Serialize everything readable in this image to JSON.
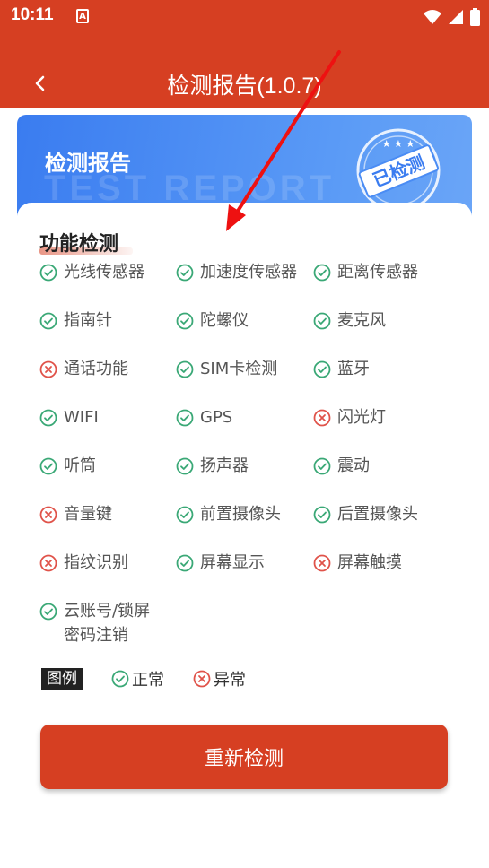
{
  "status": {
    "time": "10:11",
    "app_badge": "A"
  },
  "header": {
    "title": "检测报告(1.0.7)"
  },
  "banner": {
    "title": "检测报告",
    "watermark": "TEST REPORT",
    "stamp": "已检测"
  },
  "section": {
    "title": "功能检测"
  },
  "items": [
    {
      "label": "光线传感器",
      "status": "ok"
    },
    {
      "label": "加速度传感器",
      "status": "ok"
    },
    {
      "label": "距离传感器",
      "status": "ok"
    },
    {
      "label": "指南针",
      "status": "ok"
    },
    {
      "label": "陀螺仪",
      "status": "ok"
    },
    {
      "label": "麦克风",
      "status": "ok"
    },
    {
      "label": "通话功能",
      "status": "fail"
    },
    {
      "label": "SIM卡检测",
      "status": "ok"
    },
    {
      "label": "蓝牙",
      "status": "ok"
    },
    {
      "label": "WIFI",
      "status": "ok"
    },
    {
      "label": "GPS",
      "status": "ok"
    },
    {
      "label": "闪光灯",
      "status": "fail"
    },
    {
      "label": "听筒",
      "status": "ok"
    },
    {
      "label": "扬声器",
      "status": "ok"
    },
    {
      "label": "震动",
      "status": "ok"
    },
    {
      "label": "音量键",
      "status": "fail"
    },
    {
      "label": "前置摄像头",
      "status": "ok"
    },
    {
      "label": "后置摄像头",
      "status": "ok"
    },
    {
      "label": "指纹识别",
      "status": "fail"
    },
    {
      "label": "屏幕显示",
      "status": "ok"
    },
    {
      "label": "屏幕触摸",
      "status": "fail"
    },
    {
      "label": "云账号/锁屏\n密码注销",
      "status": "ok"
    }
  ],
  "legend": {
    "tag": "图例",
    "ok_label": "正常",
    "fail_label": "异常"
  },
  "actions": {
    "retest_label": "重新检测"
  },
  "colors": {
    "primary": "#d63f22",
    "ok": "#3aa876",
    "fail": "#e0534a",
    "banner": "#4a8cf4"
  }
}
